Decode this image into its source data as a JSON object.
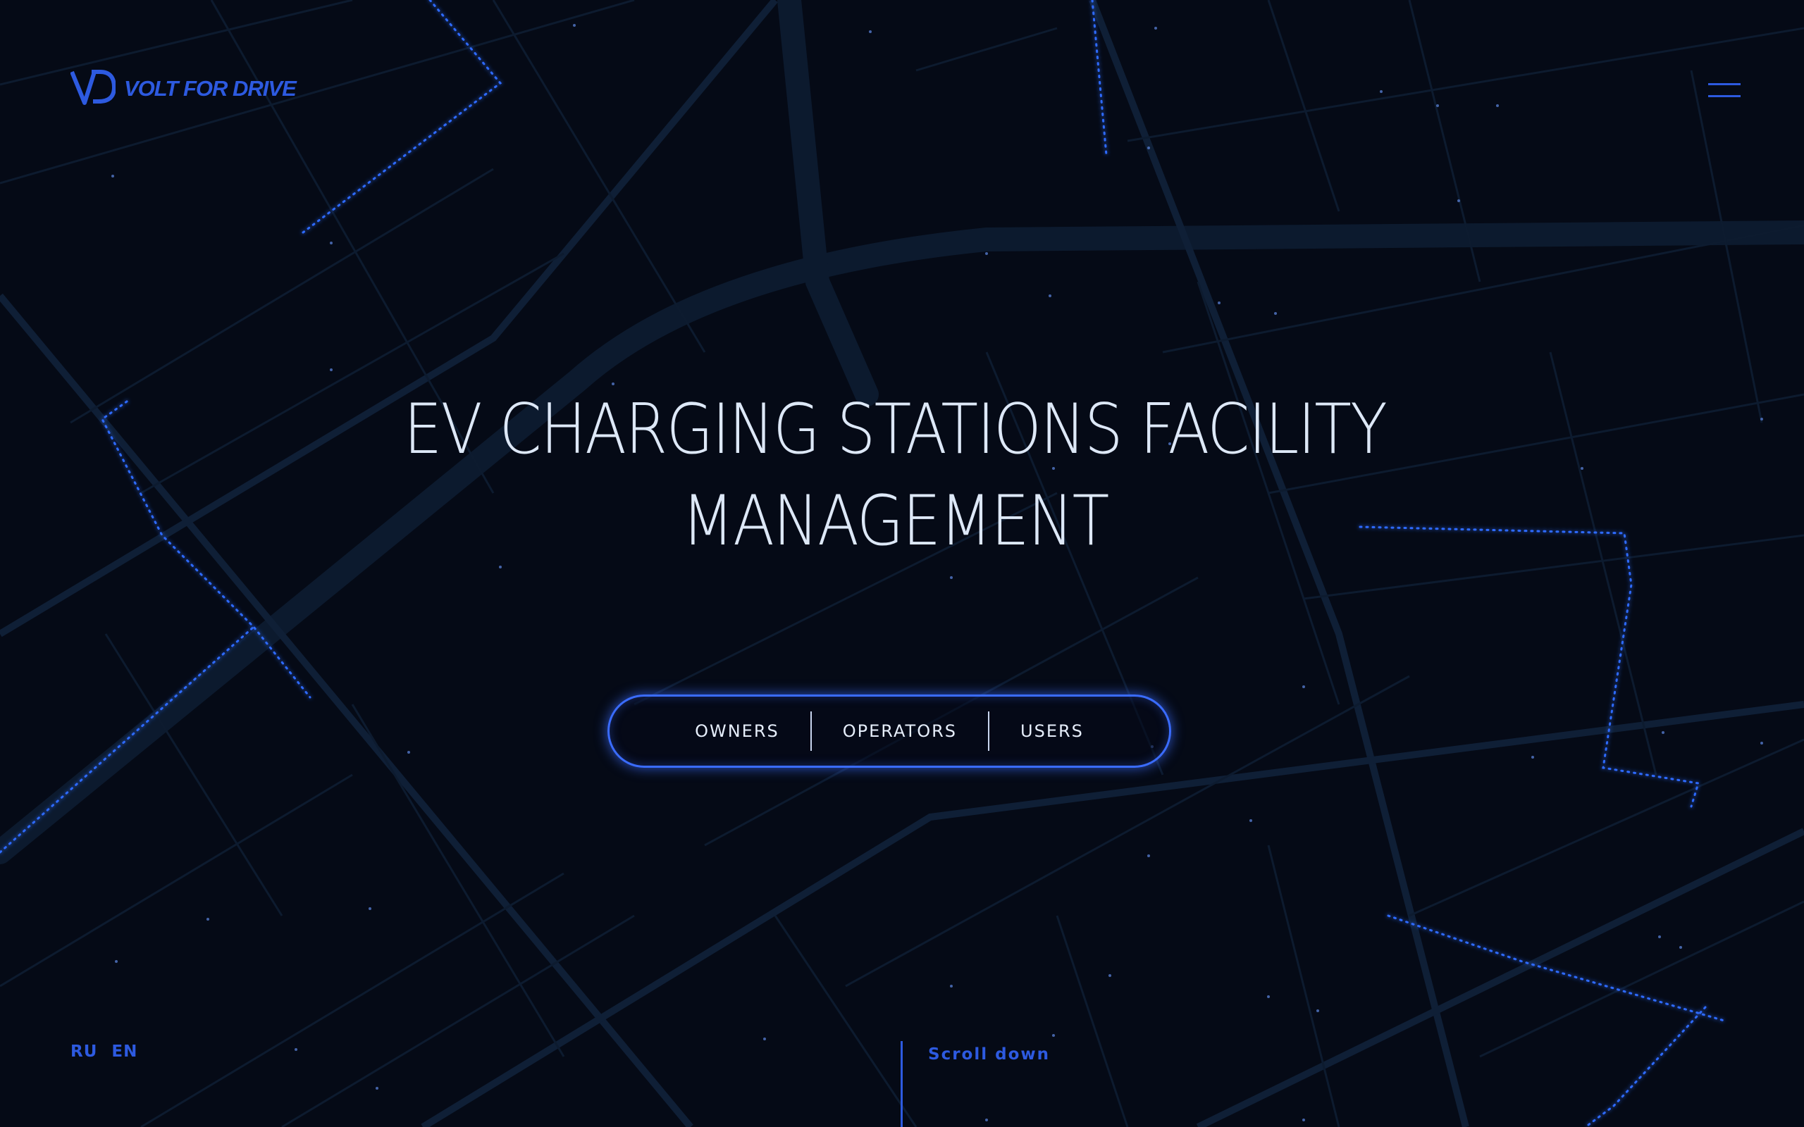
{
  "header": {
    "logo_text": "VOLT FOR DRIVE",
    "logo_icon": "vd-logo-icon",
    "menu_icon": "hamburger-menu-icon"
  },
  "hero": {
    "title_line1": "EV CHARGING STATIONS FACILITY",
    "title_line2": "MANAGEMENT"
  },
  "audience_nav": {
    "items": [
      "OWNERS",
      "OPERATORS",
      "USERS"
    ]
  },
  "footer": {
    "languages": [
      "RU",
      "EN"
    ],
    "scroll_label": "Scroll down"
  },
  "colors": {
    "background": "#050a16",
    "map_lines": "#0f1f36",
    "accent": "#2d5ae0",
    "glow": "#3a6cff",
    "title": "#dde8f7"
  }
}
